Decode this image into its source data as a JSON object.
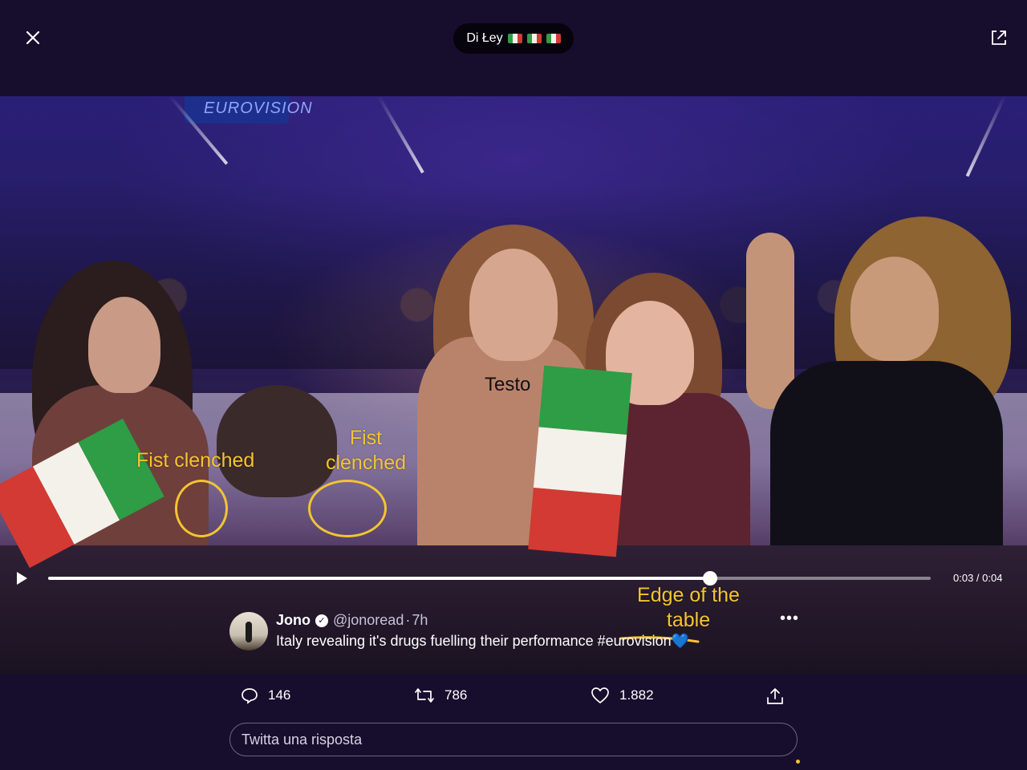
{
  "header": {
    "title": "Di Łey",
    "flags": [
      "italy-flag",
      "italy-flag",
      "italy-flag"
    ],
    "close_icon": "close-icon",
    "expand_icon": "expand-icon"
  },
  "video": {
    "banner_text": "EUROVISION",
    "overlay_text": "Testo",
    "annotations": {
      "fist_left": "Fist clenched",
      "fist_right_line1": "Fist",
      "fist_right_line2": "clenched",
      "edge_line1": "Edge of  the",
      "edge_line2": "table"
    },
    "annotation_color": "#f4c430",
    "player": {
      "progress": 0.75,
      "time": "0:03 / 0:04"
    }
  },
  "tweet": {
    "name": "Jono",
    "handle": "@jonoread",
    "separator": "·",
    "age": "7h",
    "text": "Italy revealing it's drugs fuelling their performance #eurovision",
    "emoji": "💙"
  },
  "actions": {
    "replies": "146",
    "retweets": "786",
    "likes": "1.882"
  },
  "reply": {
    "placeholder": "Twitta una risposta"
  },
  "colors": {
    "background": "#170e2e",
    "italy_green": "#2e9d45",
    "italy_white": "#f4f1ea",
    "italy_red": "#d23a33"
  }
}
